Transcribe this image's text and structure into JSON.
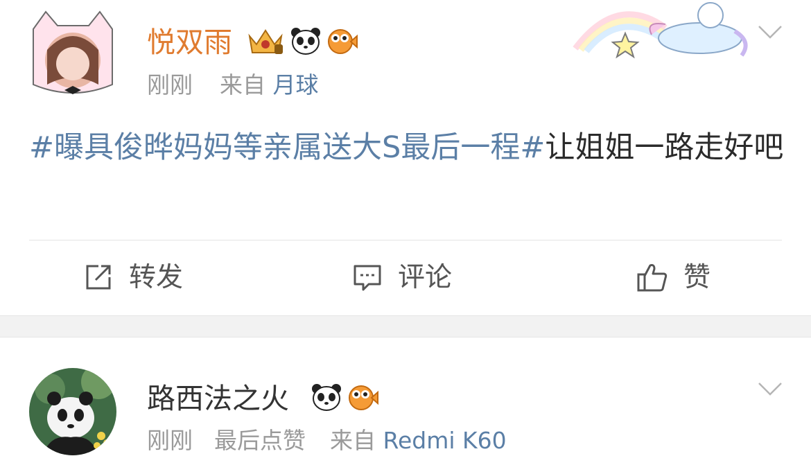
{
  "posts": [
    {
      "username": "悦双雨",
      "time": "刚刚",
      "source_prefix": "来自",
      "source": "月球",
      "topic": "#曝具俊晔妈妈等亲属送大S最后一程#",
      "text": "让姐姐一路走好吧",
      "badges": [
        "crown-badge-icon",
        "panda-icon",
        "pufferfish-icon"
      ]
    },
    {
      "username": "路西法之火",
      "time": "刚刚",
      "activity": "最后点赞",
      "source_prefix": "来自",
      "source": "Redmi K60",
      "badges": [
        "panda-icon",
        "pufferfish-icon"
      ]
    }
  ],
  "actions": {
    "repost": "转发",
    "comment": "评论",
    "like": "赞"
  },
  "colors": {
    "username_orange": "#e07b2f",
    "username_dark": "#333333",
    "link_blue": "#5b7fa6",
    "meta_gray": "#9a9a9a",
    "separator_gray": "#f2f2f2"
  }
}
